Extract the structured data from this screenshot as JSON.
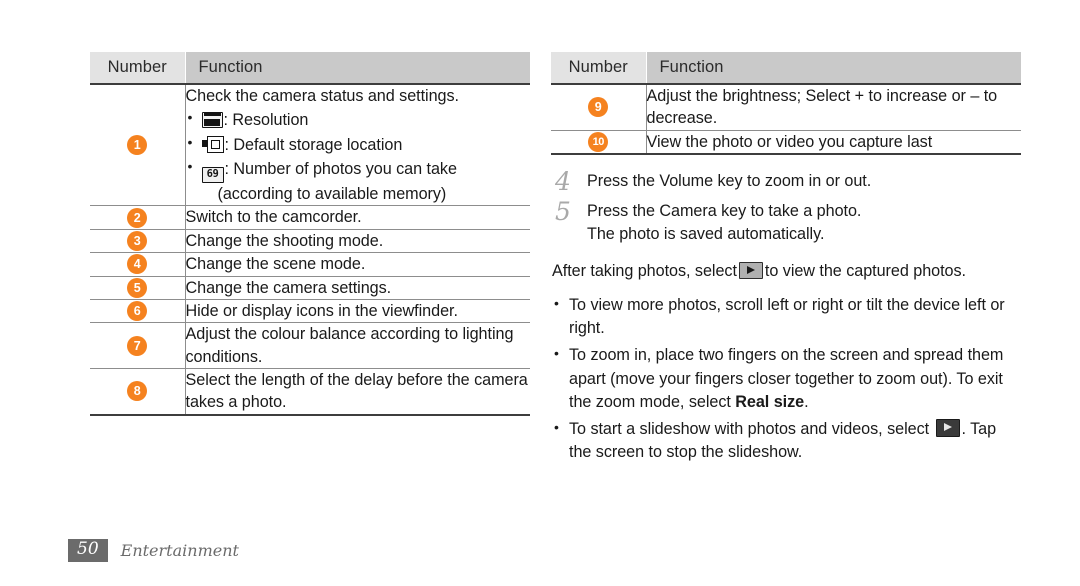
{
  "left_table": {
    "headers": {
      "number": "Number",
      "function": "Function"
    },
    "rows": [
      {
        "number": "1",
        "intro": "Check the camera status and settings.",
        "items": [
          {
            "icon": "resolution-icon",
            "text": ": Resolution"
          },
          {
            "icon": "storage-icon",
            "text": ": Default storage location"
          },
          {
            "icon": "photo-count-icon",
            "icon_text": "69",
            "text": ": Number of photos you can take",
            "cont": "(according to available memory)"
          }
        ]
      },
      {
        "number": "2",
        "text": "Switch to the camcorder."
      },
      {
        "number": "3",
        "text": "Change the shooting mode."
      },
      {
        "number": "4",
        "text": "Change the scene mode."
      },
      {
        "number": "5",
        "text": "Change the camera settings."
      },
      {
        "number": "6",
        "text": "Hide or display icons in the viewfinder."
      },
      {
        "number": "7",
        "text": "Adjust the colour balance according to lighting conditions."
      },
      {
        "number": "8",
        "text": "Select the length of the delay before the camera takes a photo."
      }
    ]
  },
  "right_table": {
    "headers": {
      "number": "Number",
      "function": "Function"
    },
    "rows": [
      {
        "number": "9",
        "text": "Adjust the brightness; Select + to increase or – to decrease."
      },
      {
        "number": "10",
        "text": "View the photo or video you capture last"
      }
    ]
  },
  "steps": [
    {
      "num": "4",
      "text": "Press the Volume key to zoom in or out.",
      "sub": ""
    },
    {
      "num": "5",
      "text": "Press the Camera key to take a photo.",
      "sub": "The photo is saved automatically."
    }
  ],
  "paragraph": {
    "before": "After taking photos, select",
    "icon": "play-button-icon-light",
    "after": "to view the captured photos."
  },
  "bullets": [
    {
      "text": "To view more photos, scroll left or right or tilt the device left or right."
    },
    {
      "pre": "To zoom in, place two fingers on the screen and spread them apart (move your fingers closer together to zoom out). To exit the zoom mode, select ",
      "bold": "Real size",
      "post": "."
    },
    {
      "pre": "To start a slideshow with photos and videos, select ",
      "icon": "play-button-icon-dark",
      "post": ". Tap the screen to stop the slideshow."
    }
  ],
  "footer": {
    "page": "50",
    "section": "Entertainment"
  },
  "colors": {
    "accent": "#f5821f",
    "header_number_bg": "#e3e3e3",
    "header_function_bg": "#c9c9c9",
    "rule": "#8d8d8d",
    "footer_gray": "#6b6b6b"
  }
}
